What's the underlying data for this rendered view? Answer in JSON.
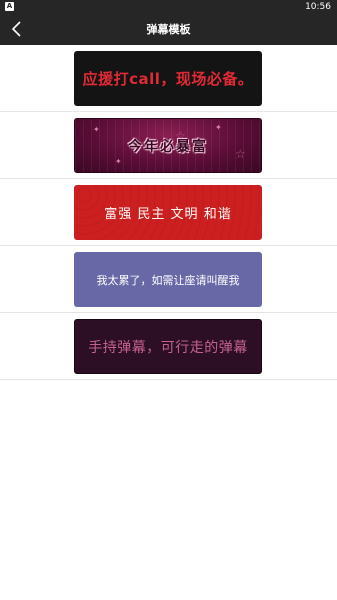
{
  "status_bar": {
    "app_icon_letter": "A",
    "time": "10:56"
  },
  "header": {
    "title": "弹幕模板",
    "back_icon": "chevron-left-icon"
  },
  "templates": [
    {
      "text": "应援打call，现场必备。",
      "style": "black-red",
      "color": "#e02a35"
    },
    {
      "text": "今年必暴富",
      "style": "magenta-curtain",
      "color": "#6a0f3c"
    },
    {
      "text": "富强 民主 文明 和谐",
      "style": "red-pattern",
      "color": "#c81f1f"
    },
    {
      "text": "我太累了，如需让座请叫醒我",
      "style": "purple",
      "color": "#6868a6"
    },
    {
      "text": "手持弹幕，可行走的弹幕",
      "style": "dark-plum",
      "color": "#2c0f24"
    }
  ],
  "colors": {
    "navbar_bg": "#262626",
    "divider": "#e6e6e6"
  }
}
